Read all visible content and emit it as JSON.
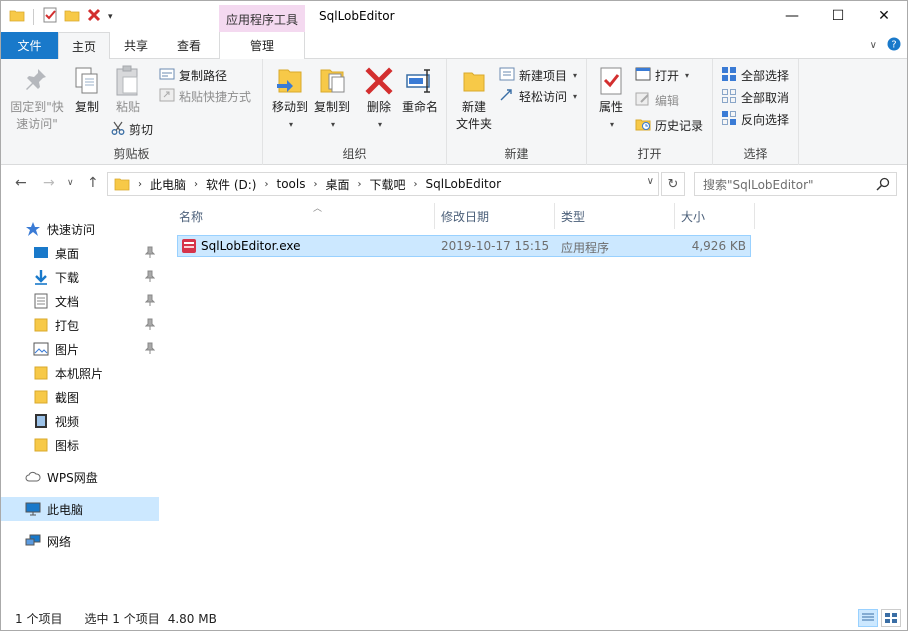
{
  "window": {
    "title": "SqlLobEditor",
    "context_tab_title": "应用程序工具",
    "controls": {
      "minimize": "—",
      "maximize": "☐",
      "close": "✕"
    }
  },
  "tabs": {
    "file": "文件",
    "home": "主页",
    "share": "共享",
    "view": "查看",
    "manage": "管理"
  },
  "ribbon": {
    "clipboard": {
      "label": "剪贴板",
      "pin": "固定到\"快\n速访问\"",
      "pin_line1": "固定到\"快",
      "pin_line2": "速访问\"",
      "copy": "复制",
      "paste": "粘贴",
      "copy_path": "复制路径",
      "paste_shortcut": "粘贴快捷方式",
      "cut": "剪切"
    },
    "organize": {
      "label": "组织",
      "move_to": "移动到",
      "copy_to": "复制到",
      "delete": "删除",
      "rename": "重命名"
    },
    "new": {
      "label": "新建",
      "new_folder_line1": "新建",
      "new_folder_line2": "文件夹",
      "new_item": "新建项目",
      "easy_access": "轻松访问"
    },
    "open": {
      "label": "打开",
      "properties": "属性",
      "open": "打开",
      "edit": "编辑",
      "history": "历史记录"
    },
    "select": {
      "label": "选择",
      "select_all": "全部选择",
      "select_none": "全部取消",
      "invert": "反向选择"
    }
  },
  "address": {
    "crumbs": [
      "此电脑",
      "软件 (D:)",
      "tools",
      "桌面",
      "下载吧",
      "SqlLobEditor"
    ],
    "search_placeholder": "搜索\"SqlLobEditor\""
  },
  "nav": {
    "quick_access": "快速访问",
    "items": [
      {
        "label": "桌面",
        "icon": "desktop-icon",
        "pinned": true
      },
      {
        "label": "下载",
        "icon": "download-icon",
        "pinned": true
      },
      {
        "label": "文档",
        "icon": "document-icon",
        "pinned": true
      },
      {
        "label": "打包",
        "icon": "folder-icon",
        "pinned": true
      },
      {
        "label": "图片",
        "icon": "pictures-icon",
        "pinned": true
      },
      {
        "label": "本机照片",
        "icon": "folder-icon",
        "pinned": false
      },
      {
        "label": "截图",
        "icon": "folder-icon",
        "pinned": false
      },
      {
        "label": "视频",
        "icon": "video-icon",
        "pinned": false
      },
      {
        "label": "图标",
        "icon": "folder-icon",
        "pinned": false
      }
    ],
    "wps": "WPS网盘",
    "this_pc": "此电脑",
    "network": "网络"
  },
  "columns": {
    "name": "名称",
    "modified": "修改日期",
    "type": "类型",
    "size": "大小"
  },
  "files": [
    {
      "name": "SqlLobEditor.exe",
      "modified": "2019-10-17 15:15",
      "type": "应用程序",
      "size": "4,926 KB"
    }
  ],
  "status": {
    "count": "1 个项目",
    "selected": "选中 1 个项目",
    "selected_size": "4.80 MB"
  },
  "colors": {
    "file_tab": "#1979ca",
    "selection": "#cce8ff",
    "context_tab": "#f4d9f0",
    "delete_red": "#d32f2f",
    "folder_yellow": "#f7c948"
  }
}
